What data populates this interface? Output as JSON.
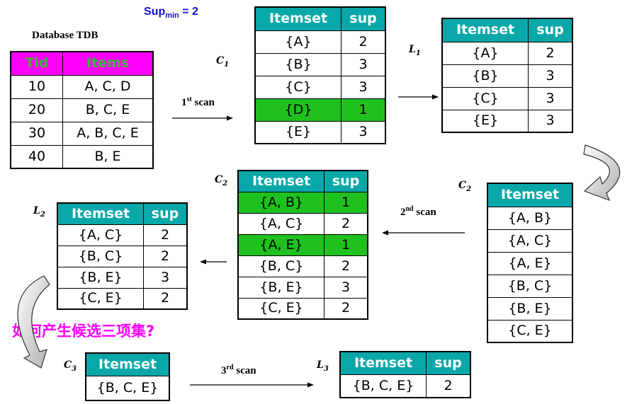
{
  "supmin": {
    "label": "Sup",
    "sub": "min",
    "value": " = 2"
  },
  "database": {
    "title": "Database TDB",
    "headers": [
      "Tid",
      "Items"
    ],
    "rows": [
      [
        "10",
        "A, C, D"
      ],
      [
        "20",
        "B, C, E"
      ],
      [
        "30",
        "A, B, C, E"
      ],
      [
        "40",
        "B, E"
      ]
    ]
  },
  "labels": {
    "c1": {
      "main": "C",
      "sub": "1"
    },
    "l1": {
      "main": "L",
      "sub": "1"
    },
    "c2a": {
      "main": "C",
      "sub": "2"
    },
    "c2b": {
      "main": "C",
      "sub": "2"
    },
    "l2": {
      "main": "L",
      "sub": "2"
    },
    "c3": {
      "main": "C",
      "sub": "3"
    },
    "l3": {
      "main": "L",
      "sub": "3"
    }
  },
  "scans": {
    "first": {
      "num": "1",
      "sup": "st",
      "text": " scan"
    },
    "second": {
      "num": "2",
      "sup": "nd",
      "text": " scan"
    },
    "third": {
      "num": "3",
      "sup": "rd",
      "text": " scan"
    }
  },
  "headers": {
    "itemset": "Itemset",
    "sup": "sup"
  },
  "c1": {
    "rows": [
      [
        "{A}",
        "2"
      ],
      [
        "{B}",
        "3"
      ],
      [
        "{C}",
        "3"
      ],
      [
        "{D}",
        "1"
      ],
      [
        "{E}",
        "3"
      ]
    ]
  },
  "l1": {
    "rows": [
      [
        "{A}",
        "2"
      ],
      [
        "{B}",
        "3"
      ],
      [
        "{C}",
        "3"
      ],
      [
        "{E}",
        "3"
      ]
    ]
  },
  "c2_candidates": {
    "rows": [
      "{A, B}",
      "{A, C}",
      "{A, E}",
      "{B, C}",
      "{B, E}",
      "{C, E}"
    ]
  },
  "c2_counted": {
    "rows": [
      [
        "{A, B}",
        "1"
      ],
      [
        "{A, C}",
        "2"
      ],
      [
        "{A, E}",
        "1"
      ],
      [
        "{B, C}",
        "2"
      ],
      [
        "{B, E}",
        "3"
      ],
      [
        "{C, E}",
        "2"
      ]
    ]
  },
  "l2": {
    "rows": [
      [
        "{A, C}",
        "2"
      ],
      [
        "{B, C}",
        "2"
      ],
      [
        "{B, E}",
        "3"
      ],
      [
        "{C, E}",
        "2"
      ]
    ]
  },
  "c3": {
    "rows": [
      "{B, C, E}"
    ]
  },
  "l3": {
    "rows": [
      [
        "{B, C, E}",
        "2"
      ]
    ]
  },
  "question": "如何产生候选三项集?",
  "colors": {
    "header": "#0aa7a9",
    "db_header": "#ff00ff",
    "db_header_text": "#3cb43c",
    "highlight": "#1fc11f",
    "question": "#ff00ff",
    "supmin": "#1010d0"
  }
}
